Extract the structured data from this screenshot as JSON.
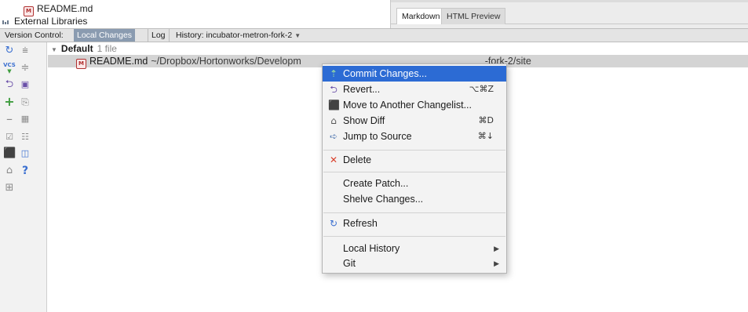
{
  "project_tree": {
    "readme_top": "README.md",
    "external_libraries": "External Libraries"
  },
  "editor_tabs": {
    "markdown": "Markdown",
    "html_preview": "HTML Preview"
  },
  "vcs_panel": {
    "title": "Version Control:",
    "tabs": [
      "Local Changes",
      "Log",
      "History: incubator-metron-fork-2"
    ],
    "active_tab": "Local Changes"
  },
  "left_toolbar": {
    "icons": [
      "refresh-icon",
      "expand-all-icon",
      "vcs-update-icon",
      "collapse-all-icon",
      "revert-icon",
      "changelist-icon",
      "add-icon",
      "copy-icon",
      "remove-icon",
      "group-icon",
      "checkbox-icon",
      "list-icon",
      "move-icon",
      "preview-icon",
      "show-diff-icon",
      "help-icon",
      "shelf-icon"
    ]
  },
  "changes": {
    "changelist_name": "Default",
    "file_count": "1 file",
    "file_name": "README.md",
    "file_path": "~/Dropbox/Hortonworks/Developm",
    "file_path_end": "-fork-2/site"
  },
  "context_menu": {
    "items": [
      {
        "label": "Commit Changes...",
        "shortcut": "",
        "icon": "commit-icon",
        "highlighted": true
      },
      {
        "label": "Revert...",
        "shortcut": "⌥⌘Z",
        "icon": "revert-icon"
      },
      {
        "label": "Move to Another Changelist...",
        "shortcut": "",
        "icon": "move-changelist-icon"
      },
      {
        "label": "Show Diff",
        "shortcut": "⌘D",
        "icon": "show-diff-icon"
      },
      {
        "label": "Jump to Source",
        "shortcut": "⌘↓",
        "icon": "jump-to-source-icon"
      },
      {
        "label": "Delete",
        "shortcut": "",
        "icon": "delete-icon"
      },
      {
        "label": "Create Patch...",
        "shortcut": "",
        "icon": ""
      },
      {
        "label": "Shelve Changes...",
        "shortcut": "",
        "icon": ""
      },
      {
        "label": "Refresh",
        "shortcut": "",
        "icon": "refresh-icon"
      },
      {
        "label": "Local History",
        "shortcut": "",
        "icon": "",
        "submenu": true
      },
      {
        "label": "Git",
        "shortcut": "",
        "icon": "",
        "submenu": true
      }
    ]
  },
  "colors": {
    "menu_highlight": "#2c6bd4",
    "active_tab": "#8a9bb0",
    "selected_row": "#d4d4d4"
  }
}
